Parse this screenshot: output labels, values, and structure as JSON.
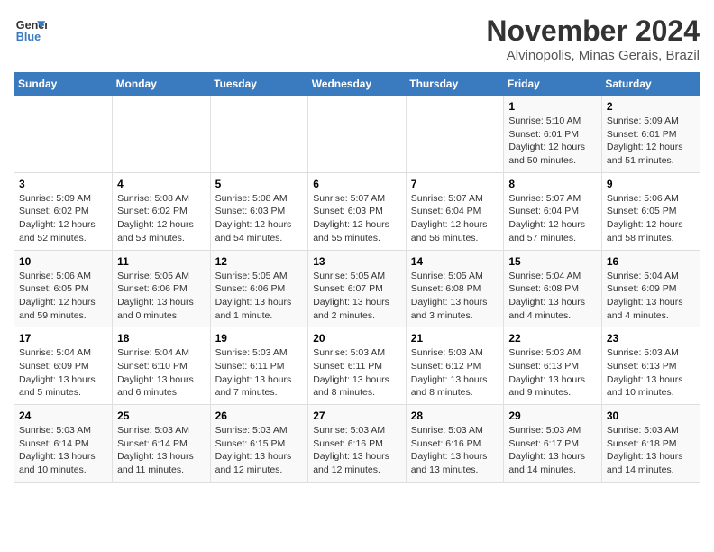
{
  "logo": {
    "line1": "General",
    "line2": "Blue"
  },
  "title": "November 2024",
  "location": "Alvinopolis, Minas Gerais, Brazil",
  "weekdays": [
    "Sunday",
    "Monday",
    "Tuesday",
    "Wednesday",
    "Thursday",
    "Friday",
    "Saturday"
  ],
  "weeks": [
    [
      {
        "day": "",
        "info": ""
      },
      {
        "day": "",
        "info": ""
      },
      {
        "day": "",
        "info": ""
      },
      {
        "day": "",
        "info": ""
      },
      {
        "day": "",
        "info": ""
      },
      {
        "day": "1",
        "info": "Sunrise: 5:10 AM\nSunset: 6:01 PM\nDaylight: 12 hours\nand 50 minutes."
      },
      {
        "day": "2",
        "info": "Sunrise: 5:09 AM\nSunset: 6:01 PM\nDaylight: 12 hours\nand 51 minutes."
      }
    ],
    [
      {
        "day": "3",
        "info": "Sunrise: 5:09 AM\nSunset: 6:02 PM\nDaylight: 12 hours\nand 52 minutes."
      },
      {
        "day": "4",
        "info": "Sunrise: 5:08 AM\nSunset: 6:02 PM\nDaylight: 12 hours\nand 53 minutes."
      },
      {
        "day": "5",
        "info": "Sunrise: 5:08 AM\nSunset: 6:03 PM\nDaylight: 12 hours\nand 54 minutes."
      },
      {
        "day": "6",
        "info": "Sunrise: 5:07 AM\nSunset: 6:03 PM\nDaylight: 12 hours\nand 55 minutes."
      },
      {
        "day": "7",
        "info": "Sunrise: 5:07 AM\nSunset: 6:04 PM\nDaylight: 12 hours\nand 56 minutes."
      },
      {
        "day": "8",
        "info": "Sunrise: 5:07 AM\nSunset: 6:04 PM\nDaylight: 12 hours\nand 57 minutes."
      },
      {
        "day": "9",
        "info": "Sunrise: 5:06 AM\nSunset: 6:05 PM\nDaylight: 12 hours\nand 58 minutes."
      }
    ],
    [
      {
        "day": "10",
        "info": "Sunrise: 5:06 AM\nSunset: 6:05 PM\nDaylight: 12 hours\nand 59 minutes."
      },
      {
        "day": "11",
        "info": "Sunrise: 5:05 AM\nSunset: 6:06 PM\nDaylight: 13 hours\nand 0 minutes."
      },
      {
        "day": "12",
        "info": "Sunrise: 5:05 AM\nSunset: 6:06 PM\nDaylight: 13 hours\nand 1 minute."
      },
      {
        "day": "13",
        "info": "Sunrise: 5:05 AM\nSunset: 6:07 PM\nDaylight: 13 hours\nand 2 minutes."
      },
      {
        "day": "14",
        "info": "Sunrise: 5:05 AM\nSunset: 6:08 PM\nDaylight: 13 hours\nand 3 minutes."
      },
      {
        "day": "15",
        "info": "Sunrise: 5:04 AM\nSunset: 6:08 PM\nDaylight: 13 hours\nand 4 minutes."
      },
      {
        "day": "16",
        "info": "Sunrise: 5:04 AM\nSunset: 6:09 PM\nDaylight: 13 hours\nand 4 minutes."
      }
    ],
    [
      {
        "day": "17",
        "info": "Sunrise: 5:04 AM\nSunset: 6:09 PM\nDaylight: 13 hours\nand 5 minutes."
      },
      {
        "day": "18",
        "info": "Sunrise: 5:04 AM\nSunset: 6:10 PM\nDaylight: 13 hours\nand 6 minutes."
      },
      {
        "day": "19",
        "info": "Sunrise: 5:03 AM\nSunset: 6:11 PM\nDaylight: 13 hours\nand 7 minutes."
      },
      {
        "day": "20",
        "info": "Sunrise: 5:03 AM\nSunset: 6:11 PM\nDaylight: 13 hours\nand 8 minutes."
      },
      {
        "day": "21",
        "info": "Sunrise: 5:03 AM\nSunset: 6:12 PM\nDaylight: 13 hours\nand 8 minutes."
      },
      {
        "day": "22",
        "info": "Sunrise: 5:03 AM\nSunset: 6:13 PM\nDaylight: 13 hours\nand 9 minutes."
      },
      {
        "day": "23",
        "info": "Sunrise: 5:03 AM\nSunset: 6:13 PM\nDaylight: 13 hours\nand 10 minutes."
      }
    ],
    [
      {
        "day": "24",
        "info": "Sunrise: 5:03 AM\nSunset: 6:14 PM\nDaylight: 13 hours\nand 10 minutes."
      },
      {
        "day": "25",
        "info": "Sunrise: 5:03 AM\nSunset: 6:14 PM\nDaylight: 13 hours\nand 11 minutes."
      },
      {
        "day": "26",
        "info": "Sunrise: 5:03 AM\nSunset: 6:15 PM\nDaylight: 13 hours\nand 12 minutes."
      },
      {
        "day": "27",
        "info": "Sunrise: 5:03 AM\nSunset: 6:16 PM\nDaylight: 13 hours\nand 12 minutes."
      },
      {
        "day": "28",
        "info": "Sunrise: 5:03 AM\nSunset: 6:16 PM\nDaylight: 13 hours\nand 13 minutes."
      },
      {
        "day": "29",
        "info": "Sunrise: 5:03 AM\nSunset: 6:17 PM\nDaylight: 13 hours\nand 14 minutes."
      },
      {
        "day": "30",
        "info": "Sunrise: 5:03 AM\nSunset: 6:18 PM\nDaylight: 13 hours\nand 14 minutes."
      }
    ]
  ]
}
